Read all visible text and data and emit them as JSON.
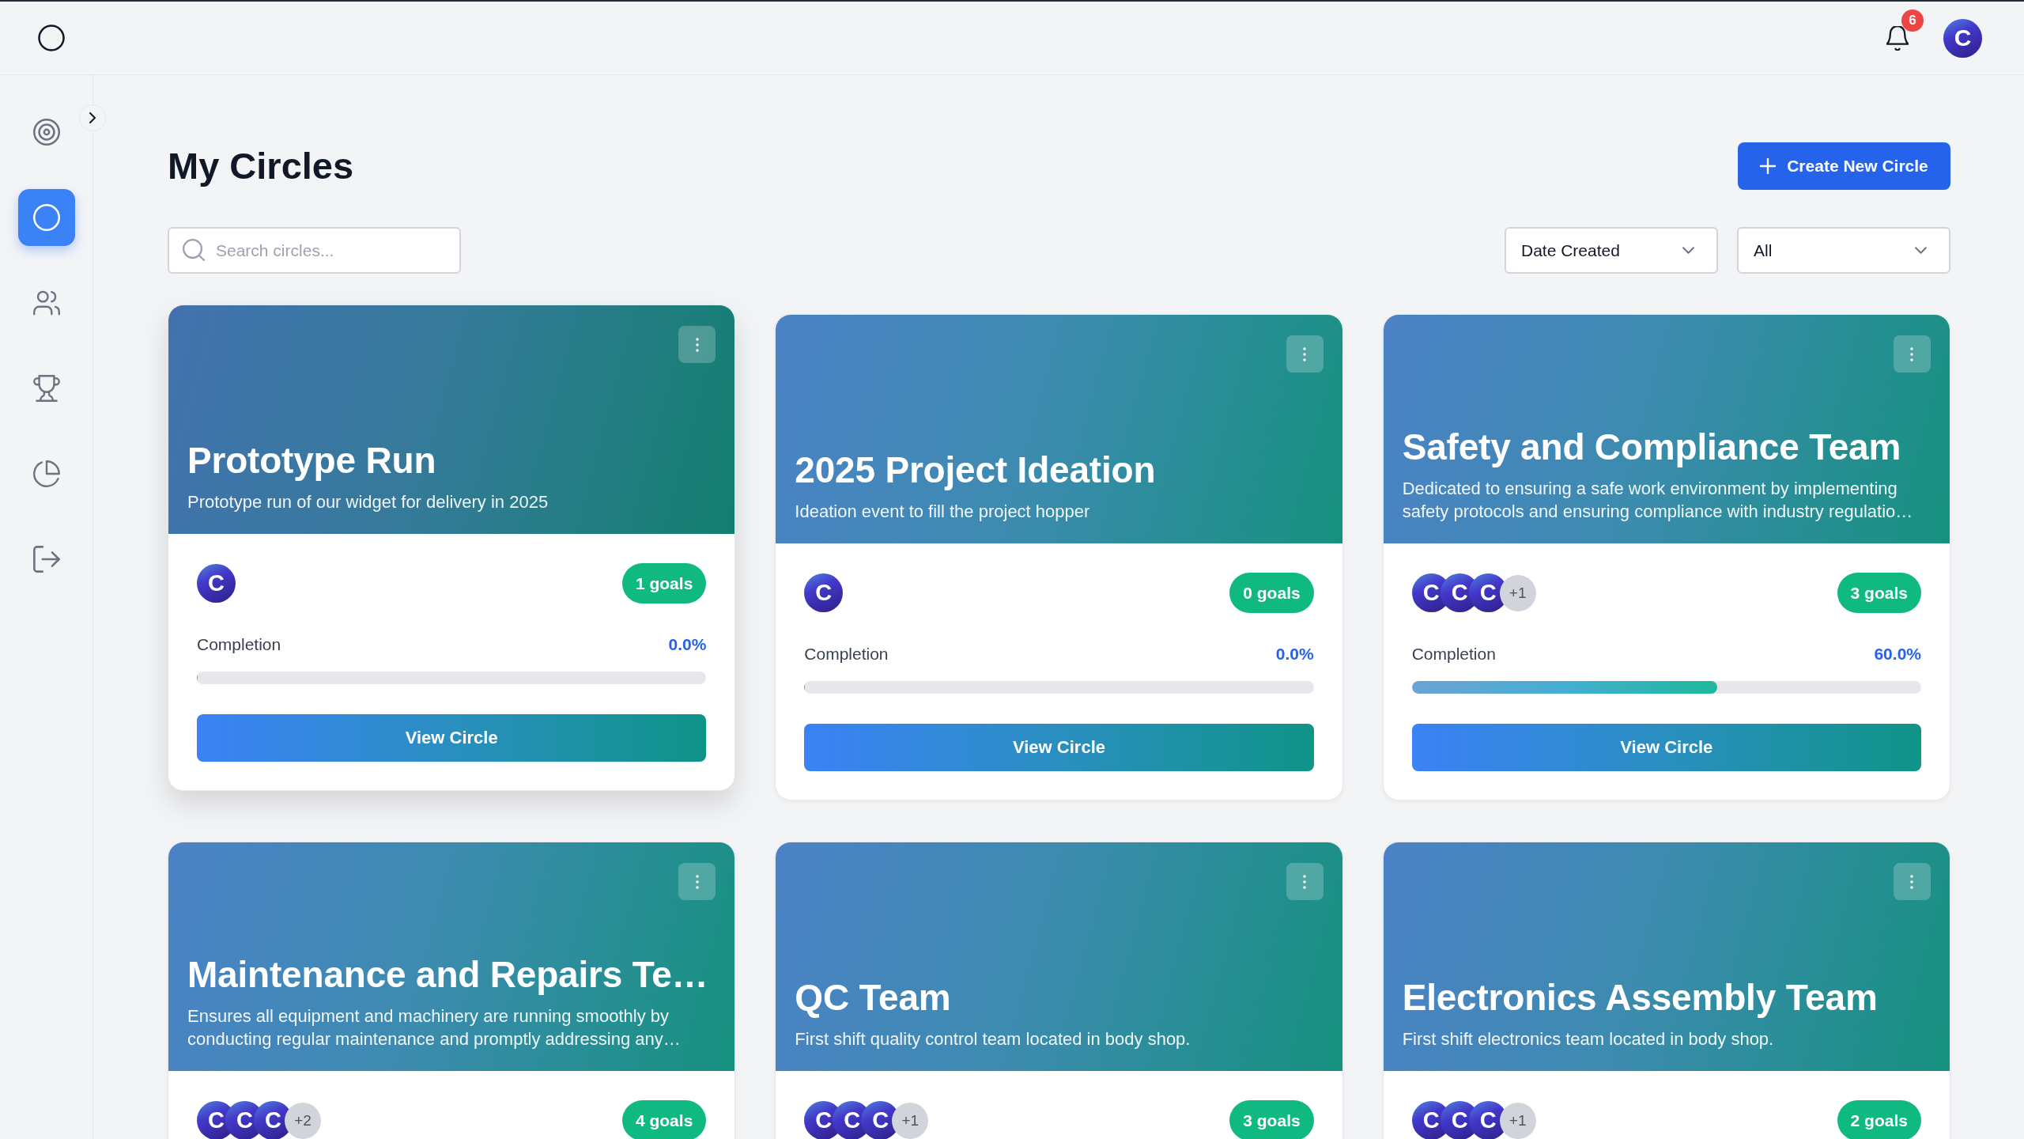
{
  "topbar": {
    "notification_count": "6",
    "user_avatar": {
      "initial": "C"
    }
  },
  "sidebar": {
    "expanded": false,
    "items": [
      {
        "kind": "target",
        "selected": false
      },
      {
        "kind": "circle",
        "selected": true
      },
      {
        "kind": "users",
        "selected": false
      },
      {
        "kind": "trophy",
        "selected": false
      },
      {
        "kind": "chart",
        "selected": false
      },
      {
        "kind": "logout",
        "selected": false
      }
    ]
  },
  "page": {
    "title": "My Circles",
    "create_button": "Create New Circle"
  },
  "filters": {
    "search": {
      "placeholder": "Search circles..."
    },
    "sort": {
      "value": "Date Created"
    },
    "status": {
      "value": "All"
    }
  },
  "circles": [
    {
      "title": "Prototype Run",
      "description": "Prototype run of our widget for delivery in 2025",
      "hovered": true,
      "members": [
        {
          "initial": "C"
        }
      ],
      "goals": "1 goals",
      "completion": {
        "label": "Completion",
        "reading": "0.0%",
        "level": 0
      },
      "action": "View Circle"
    },
    {
      "title": "2025 Project Ideation",
      "description": "Ideation event to fill the project hopper",
      "hovered": false,
      "members": [
        {
          "initial": "C"
        }
      ],
      "goals": "0 goals",
      "completion": {
        "label": "Completion",
        "reading": "0.0%",
        "level": 0
      },
      "action": "View Circle"
    },
    {
      "title": "Safety and Compliance Team",
      "description": "Dedicated to ensuring a safe work environment by implementing safety protocols and ensuring compliance with industry regulatio…",
      "hovered": false,
      "members": [
        {
          "initial": "C"
        },
        {
          "initial": "C"
        },
        {
          "initial": "C"
        }
      ],
      "more_members": "+1",
      "goals": "3 goals",
      "completion": {
        "label": "Completion",
        "reading": "60.0%",
        "level": 0.6
      },
      "action": "View Circle"
    },
    {
      "title": "Maintenance and Repairs Te…",
      "description": "Ensures all equipment and machinery are running smoothly by conducting regular maintenance and promptly addressing any…",
      "hovered": false,
      "members": [
        {
          "initial": "C"
        },
        {
          "initial": "C"
        },
        {
          "initial": "C"
        }
      ],
      "more_members": "+2",
      "goals": "4 goals"
    },
    {
      "title": "QC Team",
      "description": "First shift quality control team located in body shop.",
      "hovered": false,
      "members": [
        {
          "initial": "C"
        },
        {
          "initial": "C"
        },
        {
          "initial": "C"
        }
      ],
      "more_members": "+1",
      "goals": "3 goals"
    },
    {
      "title": "Electronics Assembly Team",
      "description": "First shift electronics team located in body shop.",
      "hovered": false,
      "members": [
        {
          "initial": "C"
        },
        {
          "initial": "C"
        },
        {
          "initial": "C"
        }
      ],
      "more_members": "+1",
      "goals": "2 goals"
    }
  ]
}
